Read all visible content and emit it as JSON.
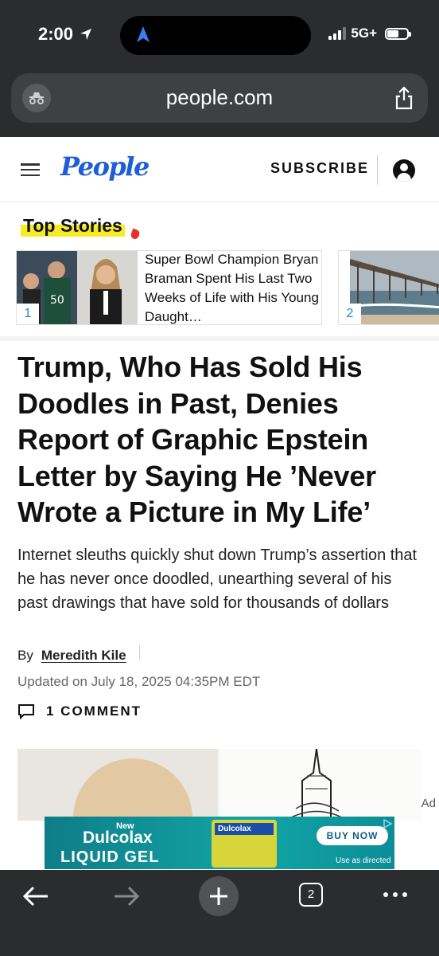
{
  "status_bar": {
    "time": "2:00",
    "network": "5G+"
  },
  "browser": {
    "url": "people.com"
  },
  "site_header": {
    "logo": "People",
    "subscribe": "SUBSCRIBE"
  },
  "top_stories": {
    "label": "Top Stories",
    "items": [
      {
        "number": "1",
        "title": "Super Bowl Champion Bryan Braman Spent His Last Two Weeks of Life with His Young Daught…"
      },
      {
        "number": "2"
      }
    ]
  },
  "article": {
    "headline": "Trump, Who Has Sold His Doodles in Past, Denies Report of Graphic Epstein Letter by Saying He ’Never Wrote a Picture in My Life’",
    "dek": "Internet sleuths quickly shut down Trump’s assertion that he has never once doodled, unearthing several of his past drawings that have sold for thousands of dollars",
    "by_prefix": "By",
    "author": "Meredith Kile",
    "updated": "Updated on July 18, 2025 04:35PM EDT",
    "comments": "1 COMMENT"
  },
  "ad": {
    "label": "Ad",
    "new": "New",
    "brand": "Dulcolax",
    "product": "LIQUID GEL",
    "box_label": "Dulcolax",
    "cta": "BUY NOW",
    "note": "Use as directed"
  },
  "toolbar": {
    "tab_count": "2"
  },
  "colors": {
    "brand_blue": "#1f5fd6",
    "highlight_yellow": "#f7ec23",
    "chrome_dark": "#2b2c2e",
    "ad_teal": "#12a5a6"
  }
}
